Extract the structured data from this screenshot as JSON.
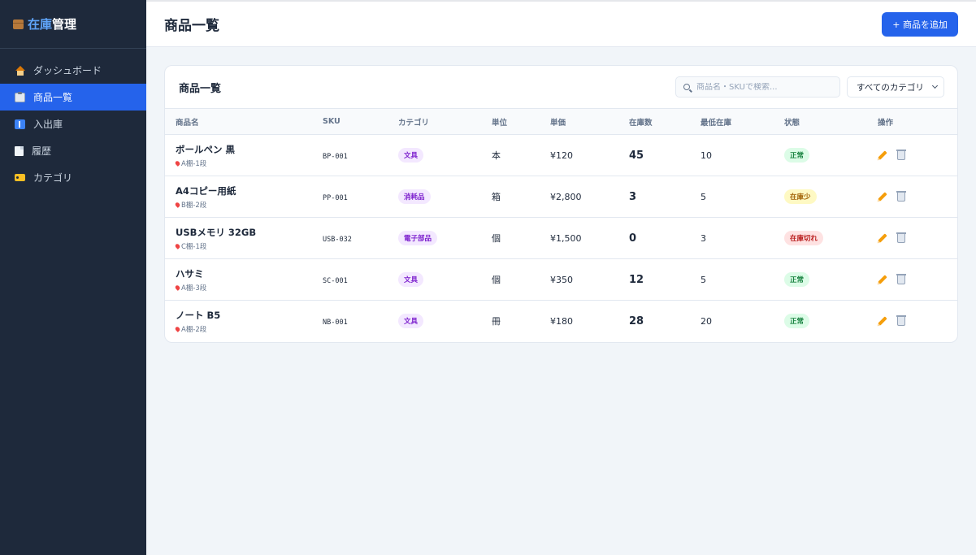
{
  "app": {
    "brand_part1": "在庫",
    "brand_part2": "管理"
  },
  "sidebar": {
    "items": [
      {
        "label": "ダッシュボード",
        "icon": "home-icon",
        "active": false
      },
      {
        "label": "商品一覧",
        "icon": "clipboard-icon",
        "active": true
      },
      {
        "label": "入出庫",
        "icon": "up-down-icon",
        "active": false
      },
      {
        "label": "履歴",
        "icon": "document-icon",
        "active": false
      },
      {
        "label": "カテゴリ",
        "icon": "tag-icon",
        "active": false
      }
    ]
  },
  "header": {
    "title": "商品一覧",
    "add_button": "+ 商品を追加"
  },
  "card": {
    "title": "商品一覧",
    "search_placeholder": "商品名・SKUで検索...",
    "category_select": "すべてのカテゴリ"
  },
  "table": {
    "columns": [
      "商品名",
      "SKU",
      "カテゴリ",
      "単位",
      "単価",
      "在庫数",
      "最低在庫",
      "状態",
      "操作"
    ],
    "rows": [
      {
        "name": "ボールペン 黒",
        "location": "A棚-1段",
        "sku": "BP-001",
        "category": "文具",
        "unit": "本",
        "price": "¥120",
        "stock": "45",
        "min_stock": "10",
        "status": "正常",
        "status_type": "ok"
      },
      {
        "name": "A4コピー用紙",
        "location": "B棚-2段",
        "sku": "PP-001",
        "category": "消耗品",
        "unit": "箱",
        "price": "¥2,800",
        "stock": "3",
        "min_stock": "5",
        "status": "在庫少",
        "status_type": "low"
      },
      {
        "name": "USBメモリ 32GB",
        "location": "C棚-1段",
        "sku": "USB-032",
        "category": "電子部品",
        "unit": "個",
        "price": "¥1,500",
        "stock": "0",
        "min_stock": "3",
        "status": "在庫切れ",
        "status_type": "out"
      },
      {
        "name": "ハサミ",
        "location": "A棚-3段",
        "sku": "SC-001",
        "category": "文具",
        "unit": "個",
        "price": "¥350",
        "stock": "12",
        "min_stock": "5",
        "status": "正常",
        "status_type": "ok"
      },
      {
        "name": "ノート B5",
        "location": "A棚-2段",
        "sku": "NB-001",
        "category": "文具",
        "unit": "冊",
        "price": "¥180",
        "stock": "28",
        "min_stock": "20",
        "status": "正常",
        "status_type": "ok"
      }
    ]
  },
  "colors": {
    "accent": "#2563eb",
    "sidebar_bg": "#1e293b",
    "status_ok": "#15803d",
    "status_low": "#a16207",
    "status_out": "#b91c1c"
  }
}
